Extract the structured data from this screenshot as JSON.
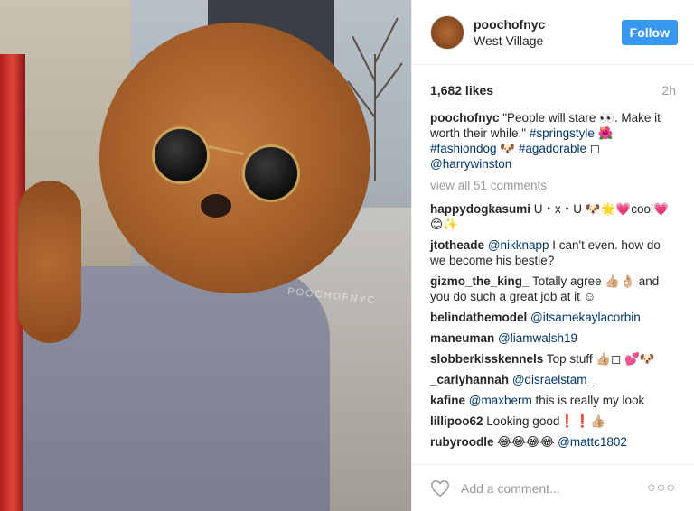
{
  "post": {
    "username": "poochofnyc",
    "location": "West Village",
    "follow_label": "Follow",
    "likes": "1,682 likes",
    "time": "2h",
    "watermark": "POOCHOFNYC"
  },
  "caption": {
    "user": "poochofnyc",
    "text1": " \"People will stare 👀. Make it worth their while.\" ",
    "tag1": "#springstyle",
    "emoji1": " 🌺 ",
    "tag2": "#fashiondog",
    "emoji2": " 🐶 ",
    "tag3": "#agadorable",
    "emoji3": " ◻ ",
    "mention": "@harrywinston"
  },
  "view_all": "view all 51 comments",
  "comments": [
    {
      "user": "happydogkasumi",
      "text": " U・x・U 🐶🌟💗cool💗😊✨",
      "mention": ""
    },
    {
      "user": "jtotheade",
      "mention": "@nikknapp",
      "text": " I can't even. how do we become his bestie?"
    },
    {
      "user": "gizmo_the_king_",
      "text": " Totally agree 👍🏼👌🏼 and you do such a great job at it ☺",
      "mention": ""
    },
    {
      "user": "belindathemodel",
      "mention": "@itsamekaylacorbin",
      "text": ""
    },
    {
      "user": "maneuman",
      "mention": "@liamwalsh19",
      "text": ""
    },
    {
      "user": "slobberkisskennels",
      "text": " Top stuff 👍🏼◻ 💕🐶",
      "mention": ""
    },
    {
      "user": "_carlyhannah",
      "mention": "@disraelstam_",
      "text": ""
    },
    {
      "user": "kafine",
      "mention": "@maxberm",
      "text": " this is really my look"
    },
    {
      "user": "lillipoo62",
      "text": " Looking good❗❗👍🏼",
      "mention": ""
    },
    {
      "user": "rubyroodle",
      "text": " 😂😂😂😂 ",
      "mention": "@mattc1802"
    }
  ],
  "footer": {
    "placeholder": "Add a comment...",
    "more": "○○○",
    "heart_icon": "heart-icon"
  }
}
